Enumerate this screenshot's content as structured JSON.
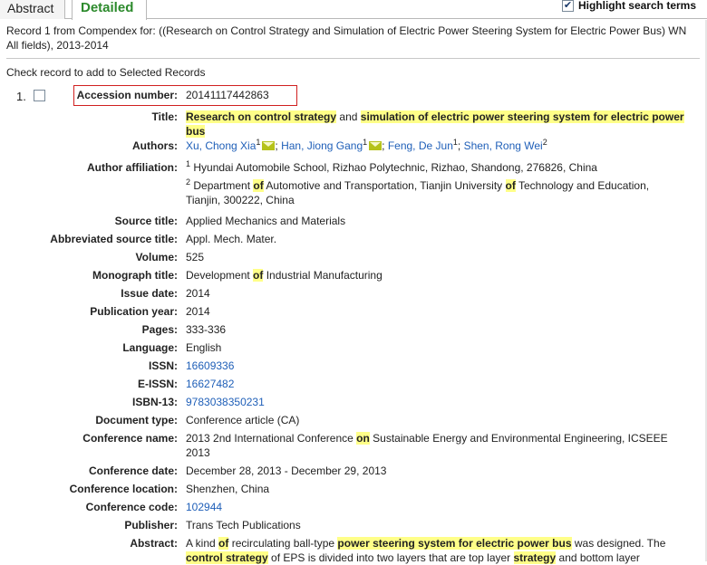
{
  "tabs": {
    "abstract": "Abstract",
    "detailed": "Detailed"
  },
  "highlight_toggle": {
    "label": "Highlight search terms",
    "checked": true
  },
  "record_header": "Record 1 from Compendex for: ((Research on Control Strategy and Simulation of Electric Power Steering System for Electric Power Bus) WN All fields), 2013-2014",
  "check_record_label": "Check record to add to Selected Records",
  "record": {
    "number": "1.",
    "accession_label": "Accession number:",
    "accession_value": "20141117442863",
    "title_label": "Title:",
    "title_segments": [
      {
        "text": "Research on control strategy",
        "hl": true
      },
      {
        "text": " and ",
        "hl": false
      },
      {
        "text": "simulation of electric power steering system for electric power bus",
        "hl": true
      }
    ],
    "authors_label": "Authors:",
    "authors": [
      {
        "name": "Xu, Chong Xia",
        "sup": "1",
        "email": true,
        "sep": "; "
      },
      {
        "name": "Han, Jiong Gang",
        "sup": "1",
        "email": true,
        "sep": "; "
      },
      {
        "name": "Feng, De Jun",
        "sup": "1",
        "email": false,
        "sep": "; "
      },
      {
        "name": "Shen, Rong Wei",
        "sup": "2",
        "email": false,
        "sep": ""
      }
    ],
    "affiliation_label": "Author affiliation:",
    "affiliation_1_sup": "1",
    "affiliation_1": "Hyundai Automobile School, Rizhao Polytechnic, Rizhao, Shandong, 276826, China",
    "affiliation_2_sup": "2",
    "affiliation_2_segments": [
      {
        "text": "Department ",
        "hl": false
      },
      {
        "text": "of",
        "hl": true
      },
      {
        "text": " Automotive and Transportation, Tianjin University ",
        "hl": false
      },
      {
        "text": "of",
        "hl": true
      },
      {
        "text": " Technology and Education, Tianjin, 300222, China",
        "hl": false
      }
    ],
    "source_title_label": "Source title:",
    "source_title": "Applied Mechanics and Materials",
    "abbrev_label": "Abbreviated source title:",
    "abbrev": "Appl. Mech. Mater.",
    "volume_label": "Volume:",
    "volume": "525",
    "monograph_label": "Monograph title:",
    "monograph_segments": [
      {
        "text": "Development ",
        "hl": false
      },
      {
        "text": "of",
        "hl": true
      },
      {
        "text": " Industrial Manufacturing",
        "hl": false
      }
    ],
    "issue_date_label": "Issue date:",
    "issue_date": "2014",
    "pub_year_label": "Publication year:",
    "pub_year": "2014",
    "pages_label": "Pages:",
    "pages": "333-336",
    "language_label": "Language:",
    "language": "English",
    "issn_label": "ISSN:",
    "issn": "16609336",
    "eissn_label": "E-ISSN:",
    "eissn": "16627482",
    "isbn_label": "ISBN-13:",
    "isbn": "9783038350231",
    "doctype_label": "Document type:",
    "doctype": "Conference article (CA)",
    "conf_name_label": "Conference name:",
    "conf_name_segments": [
      {
        "text": "2013 2nd International Conference ",
        "hl": false
      },
      {
        "text": "on",
        "hl": true
      },
      {
        "text": " Sustainable Energy and Environmental Engineering, ICSEEE 2013",
        "hl": false
      }
    ],
    "conf_date_label": "Conference date:",
    "conf_date": "December 28, 2013 - December 29, 2013",
    "conf_loc_label": "Conference location:",
    "conf_loc": "Shenzhen, China",
    "conf_code_label": "Conference code:",
    "conf_code": "102944",
    "publisher_label": "Publisher:",
    "publisher": "Trans Tech Publications",
    "abstract_label": "Abstract:",
    "abstract_segments": [
      {
        "text": "A kind ",
        "hl": false
      },
      {
        "text": "of",
        "hl": true
      },
      {
        "text": " recirculating ball-type ",
        "hl": false
      },
      {
        "text": "power steering system for electric power bus",
        "hl": true
      },
      {
        "text": " was designed. The ",
        "hl": false
      },
      {
        "text": "control strategy",
        "hl": true
      },
      {
        "text": " of EPS is divided into two layers that are top layer ",
        "hl": false
      },
      {
        "text": "strategy",
        "hl": true
      },
      {
        "text": " and bottom layer",
        "hl": false
      }
    ]
  }
}
